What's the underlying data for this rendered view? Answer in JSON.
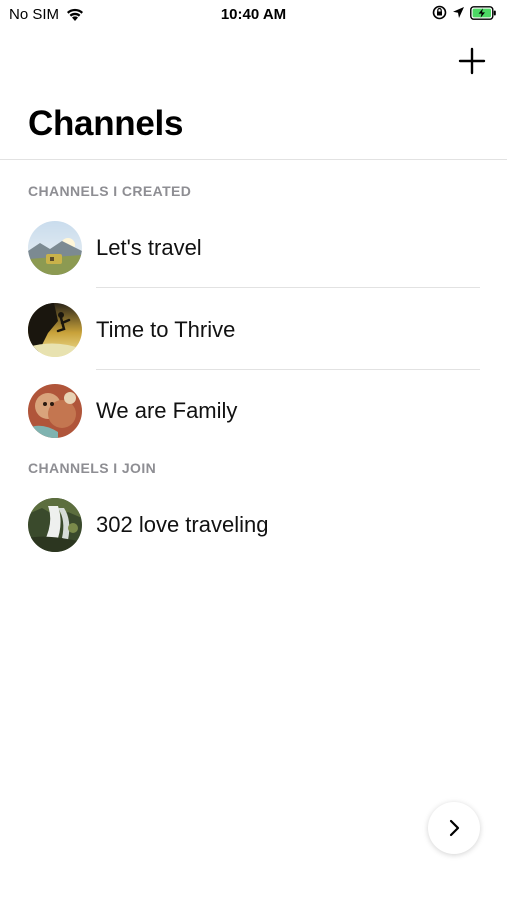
{
  "status_bar": {
    "carrier": "No SIM",
    "time": "10:40 AM",
    "icons": [
      "wifi-icon",
      "orientation-lock-icon",
      "location-arrow-icon",
      "battery-charging-icon"
    ]
  },
  "nav": {
    "title": "Channels",
    "add_icon": "plus-icon"
  },
  "sections": [
    {
      "header": "CHANNELS I CREATED",
      "items": [
        {
          "name": "Let's travel",
          "avatar": "travel-avatar"
        },
        {
          "name": "Time to Thrive",
          "avatar": "climber-avatar"
        },
        {
          "name": "We are Family",
          "avatar": "family-avatar"
        }
      ]
    },
    {
      "header": "CHANNELS I JOIN",
      "items": [
        {
          "name": "302 love traveling",
          "avatar": "waterfall-avatar"
        }
      ]
    }
  ],
  "floating_button": {
    "icon": "chevron-right-icon"
  },
  "colors": {
    "section_header": "#8e8e93",
    "divider": "#e2e2e2",
    "text": "#111111"
  }
}
